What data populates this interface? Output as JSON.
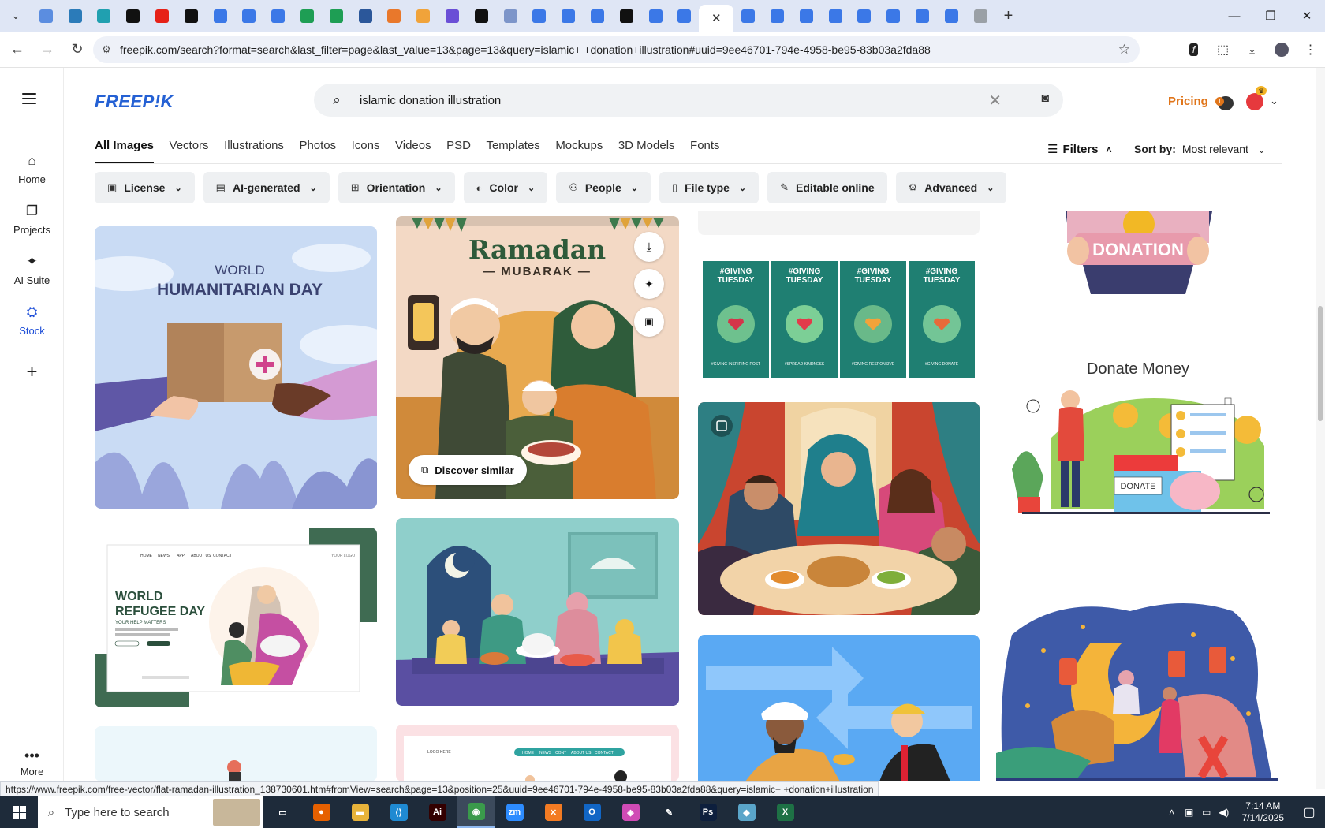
{
  "browser": {
    "tabs": [
      {
        "icon": "globe-icon",
        "color": "#5b8de0",
        "glyph": ""
      },
      {
        "icon": "vpn-icon",
        "color": "#2b7bb9",
        "glyph": ""
      },
      {
        "icon": "arrow-icon",
        "color": "#20a0b0",
        "glyph": ""
      },
      {
        "icon": "github-icon",
        "color": "#111111",
        "glyph": ""
      },
      {
        "icon": "youtube-icon",
        "color": "#e62117",
        "glyph": ""
      },
      {
        "icon": "bolt-icon",
        "color": "#111111",
        "glyph": ""
      },
      {
        "icon": "docs-icon",
        "color": "#3b78e7",
        "glyph": ""
      },
      {
        "icon": "docs-icon",
        "color": "#3b78e7",
        "glyph": ""
      },
      {
        "icon": "docs-icon",
        "color": "#3b78e7",
        "glyph": ""
      },
      {
        "icon": "sheets-icon",
        "color": "#1e9e54",
        "glyph": ""
      },
      {
        "icon": "sheets-icon",
        "color": "#1e9e54",
        "glyph": ""
      },
      {
        "icon": "word-icon",
        "color": "#2b579a",
        "glyph": ""
      },
      {
        "icon": "xampp-icon",
        "color": "#e9782b",
        "glyph": ""
      },
      {
        "icon": "bookmark-icon",
        "color": "#f0a33a",
        "glyph": ""
      },
      {
        "icon": "brackets-icon",
        "color": "#6a4fd6",
        "glyph": ""
      },
      {
        "icon": "a-icon",
        "color": "#111111",
        "glyph": ""
      },
      {
        "icon": "grid-icon",
        "color": "#7d95c9",
        "glyph": ""
      },
      {
        "icon": "docs-icon",
        "color": "#3b78e7",
        "glyph": ""
      },
      {
        "icon": "docs-icon",
        "color": "#3b78e7",
        "glyph": ""
      },
      {
        "icon": "docs-icon",
        "color": "#3b78e7",
        "glyph": ""
      },
      {
        "icon": "m-icon",
        "color": "#111111",
        "glyph": ""
      },
      {
        "icon": "docs-icon",
        "color": "#3b78e7",
        "glyph": ""
      },
      {
        "icon": "docs-icon",
        "color": "#3b78e7",
        "glyph": ""
      }
    ],
    "tabs_after": [
      {
        "icon": "docs-icon",
        "color": "#3b78e7"
      },
      {
        "icon": "docs-icon",
        "color": "#3b78e7"
      },
      {
        "icon": "docs-icon",
        "color": "#3b78e7"
      },
      {
        "icon": "docs-icon",
        "color": "#3b78e7"
      },
      {
        "icon": "docs-icon",
        "color": "#3b78e7"
      },
      {
        "icon": "docs-icon",
        "color": "#3b78e7"
      },
      {
        "icon": "docs-icon",
        "color": "#3b78e7"
      },
      {
        "icon": "docs-icon",
        "color": "#3b78e7"
      },
      {
        "icon": "chrome-icon",
        "color": "#9aa0a6"
      }
    ],
    "active_tab_close": "✕",
    "new_tab": "+",
    "url": "freepik.com/search?format=search&last_filter=page&last_value=13&page=13&query=islamic+ +donation+illustration#uuid=9ee46701-794e-4958-be95-83b03a2fda88",
    "status_url": "https://www.freepik.com/free-vector/flat-ramadan-illustration_138730601.htm#fromView=search&page=13&position=25&uuid=9ee46701-794e-4958-be95-83b03a2fda88&query=islamic+ +donation+illustration"
  },
  "sidebar": {
    "items": [
      {
        "label": "Home",
        "icon": "home-icon"
      },
      {
        "label": "Projects",
        "icon": "projects-icon"
      },
      {
        "label": "AI Suite",
        "icon": "sparkle-icon"
      },
      {
        "label": "Stock",
        "icon": "stock-icon"
      }
    ],
    "more_label": "More"
  },
  "header": {
    "logo": "FREEP!K",
    "search_query": "islamic  donation illustration",
    "pricing": "Pricing",
    "notification_count": "1"
  },
  "categories": [
    "All Images",
    "Vectors",
    "Illustrations",
    "Photos",
    "Icons",
    "Videos",
    "PSD",
    "Templates",
    "Mockups",
    "3D Models",
    "Fonts"
  ],
  "filters": {
    "label": "Filters",
    "sort_label": "Sort by:",
    "sort_value": "Most relevant",
    "chips": [
      {
        "label": "License",
        "icon": "license-icon",
        "dropdown": true
      },
      {
        "label": "AI-generated",
        "icon": "ai-icon",
        "dropdown": true
      },
      {
        "label": "Orientation",
        "icon": "orientation-icon",
        "dropdown": true
      },
      {
        "label": "Color",
        "icon": "palette-icon",
        "dropdown": true
      },
      {
        "label": "People",
        "icon": "people-icon",
        "dropdown": true
      },
      {
        "label": "File type",
        "icon": "file-icon",
        "dropdown": true
      },
      {
        "label": "Editable online",
        "icon": "pen-icon",
        "dropdown": false
      },
      {
        "label": "Advanced",
        "icon": "gear-icon",
        "dropdown": true
      }
    ]
  },
  "results": {
    "humanitarian": {
      "line1": "WORLD",
      "line2": "HUMANITARIAN DAY"
    },
    "ramadan": {
      "title": "Ramadan",
      "subtitle": "— MUBARAK —",
      "discover": "Discover similar"
    },
    "refugee": {
      "line1": "WORLD",
      "line2": "REFUGEE DAY",
      "tagline": "YOUR HELP MATTERS",
      "nav": [
        "HOME",
        "NEWS",
        "APP",
        "ABOUT US",
        "CONTACT"
      ],
      "logo": "YOUR LOGO",
      "body": "Lorem ipsum dolor sit amet, consectetur adipiscing elit, sed do eiusmod tempor.",
      "btn1": "DONATE NOW",
      "btn2": "READ MORE",
      "footer": "www.yourwebsitename.com"
    },
    "giving_tuesday": {
      "panels": [
        "#GIVING TUESDAY",
        "#GIVING TUESDAY",
        "#GIVING TUESDAY",
        "#GIVING TUESDAY"
      ],
      "captions": [
        "#GIVING INSPIRING POST",
        "#SPREAD KINDNESS",
        "#GIVING RESPONSIVE",
        "#GIVING DONATE"
      ]
    },
    "donation_banner": "DONATION",
    "donate_money": {
      "title": "Donate Money",
      "tag": "DONATE"
    },
    "landing_nav": [
      "HOME",
      "NEWS",
      "CONT",
      "ABOUT US",
      "CONTACT"
    ],
    "landing_logo": "LOGO HERE"
  },
  "taskbar": {
    "search_placeholder": "Type here to search",
    "apps": [
      {
        "icon": "task-view-icon",
        "color": "#1e2b3a",
        "glyph": "▭"
      },
      {
        "icon": "firefox-icon",
        "color": "#e66000",
        "glyph": "●"
      },
      {
        "icon": "file-explorer-icon",
        "color": "#e8b33a",
        "glyph": "▬"
      },
      {
        "icon": "vscode-icon",
        "color": "#1f8ad2",
        "glyph": "⟨⟩"
      },
      {
        "icon": "illustrator-icon",
        "color": "#330000",
        "glyph": "Ai"
      },
      {
        "icon": "chrome-icon",
        "color": "#3a9a4b",
        "glyph": "◉"
      },
      {
        "icon": "zoom-icon",
        "color": "#2d8cff",
        "glyph": "zm"
      },
      {
        "icon": "xampp-icon",
        "color": "#f37b23",
        "glyph": "✕"
      },
      {
        "icon": "outlook-icon",
        "color": "#1166c5",
        "glyph": "O"
      },
      {
        "icon": "paint-icon",
        "color": "#d04bb5",
        "glyph": "◈"
      },
      {
        "icon": "pen-tool-icon",
        "color": "#1e2b3a",
        "glyph": "✎"
      },
      {
        "icon": "photoshop-icon",
        "color": "#0d1f3d",
        "glyph": "Ps"
      },
      {
        "icon": "diamond-icon",
        "color": "#5aa5c9",
        "glyph": "◆"
      },
      {
        "icon": "excel-icon",
        "color": "#1e7145",
        "glyph": "X"
      }
    ],
    "time": "7:14 AM",
    "date": "7/14/2025"
  }
}
